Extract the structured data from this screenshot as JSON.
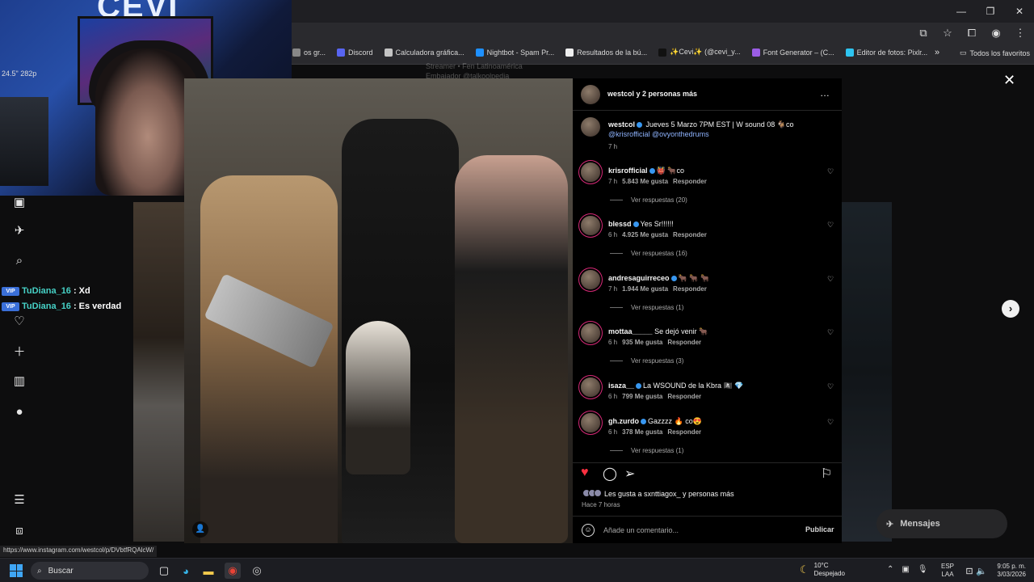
{
  "browser": {
    "bookmarks": [
      {
        "label": "os gr...",
        "color": "#888888"
      },
      {
        "label": "Discord",
        "color": "#5865f2"
      },
      {
        "label": "Calculadora gráfica...",
        "color": "#c4c4c4"
      },
      {
        "label": "Nightbot - Spam Pr...",
        "color": "#1e90ff"
      },
      {
        "label": "Resultados de la bú...",
        "color": "#eeeeee"
      },
      {
        "label": "✨Cevi✨ (@cevi_y...",
        "color": "#111111"
      },
      {
        "label": "Font Generator – (C...",
        "color": "#9b5de5"
      },
      {
        "label": "Editor de fotos: Pixlr...",
        "color": "#2ec4f0"
      }
    ],
    "more_label": "»",
    "all_favorites": "Todos los favoritos",
    "status_url": "https://www.instagram.com/westcol/p/DVbtfRQAlcW/"
  },
  "webcam": {
    "brand_text": "CEVI",
    "shelf_text": "24.5\" 282p"
  },
  "background_caption": {
    "line1": "Streamer • Fen Latinoamérica",
    "line2": "Embajador @talkoolpedia"
  },
  "chat": [
    {
      "badge": "VIP",
      "user": "TuDiana_16",
      "message": ": Xd"
    },
    {
      "badge": "VIP",
      "user": "TuDiana_16",
      "message": ": Es verdad"
    }
  ],
  "post": {
    "header_title": "westcol y 2 personas más",
    "more_icon": "…",
    "caption": {
      "user": "westcol",
      "text": "Jueves 5 Marzo 7PM EST | W sound 08 🐐co",
      "mentions": "@krisrofficial @ovyonthedrums",
      "time": "7 h"
    },
    "comments": [
      {
        "user": "krisrofficial",
        "verified": true,
        "text": "👹 🐂co",
        "time": "7 h",
        "likes": "5.843 Me gusta",
        "reply": "Responder",
        "replies": "Ver respuestas (20)"
      },
      {
        "user": "blessd",
        "verified": true,
        "text": "Yes Sr!!!!!!",
        "time": "6 h",
        "likes": "4.925 Me gusta",
        "reply": "Responder",
        "replies": "Ver respuestas (16)"
      },
      {
        "user": "andresaguirreceo",
        "verified": true,
        "text": "🐂 🐂 🐂",
        "time": "7 h",
        "likes": "1.944 Me gusta",
        "reply": "Responder",
        "replies": "Ver respuestas (1)"
      },
      {
        "user": "mottaa_____",
        "verified": false,
        "text": "Se dejó venir 🐂",
        "time": "6 h",
        "likes": "935 Me gusta",
        "reply": "Responder",
        "replies": "Ver respuestas (3)"
      },
      {
        "user": "isaza__",
        "verified": true,
        "text": "La WSOUND de la Kbra 🏴‍☠️ 💎",
        "time": "6 h",
        "likes": "799 Me gusta",
        "reply": "Responder",
        "replies": ""
      },
      {
        "user": "gh.zurdo",
        "verified": true,
        "text": "Gazzzz 🔥 co😍",
        "time": "6 h",
        "likes": "378 Me gusta",
        "reply": "Responder",
        "replies": "Ver respuestas (1)"
      }
    ],
    "likes_text": "Les gusta a sxnttiagox_ y personas más",
    "time_ago": "Hace 7 horas",
    "comment_placeholder": "Añade un comentario...",
    "publish_label": "Publicar"
  },
  "messages_label": "Mensajes",
  "taskbar": {
    "search_label": "Buscar",
    "weather_temp": "10°C",
    "weather_desc": "Despejado",
    "lang_top": "ESP",
    "lang_bottom": "LAA",
    "time": "9:05 p. m.",
    "date": "3/03/2026"
  },
  "colors": {
    "accent_like": "#ff3040",
    "verified": "#3897f0",
    "chat_user": "#46d1c6",
    "windows_blue": "#3fa6f5"
  }
}
